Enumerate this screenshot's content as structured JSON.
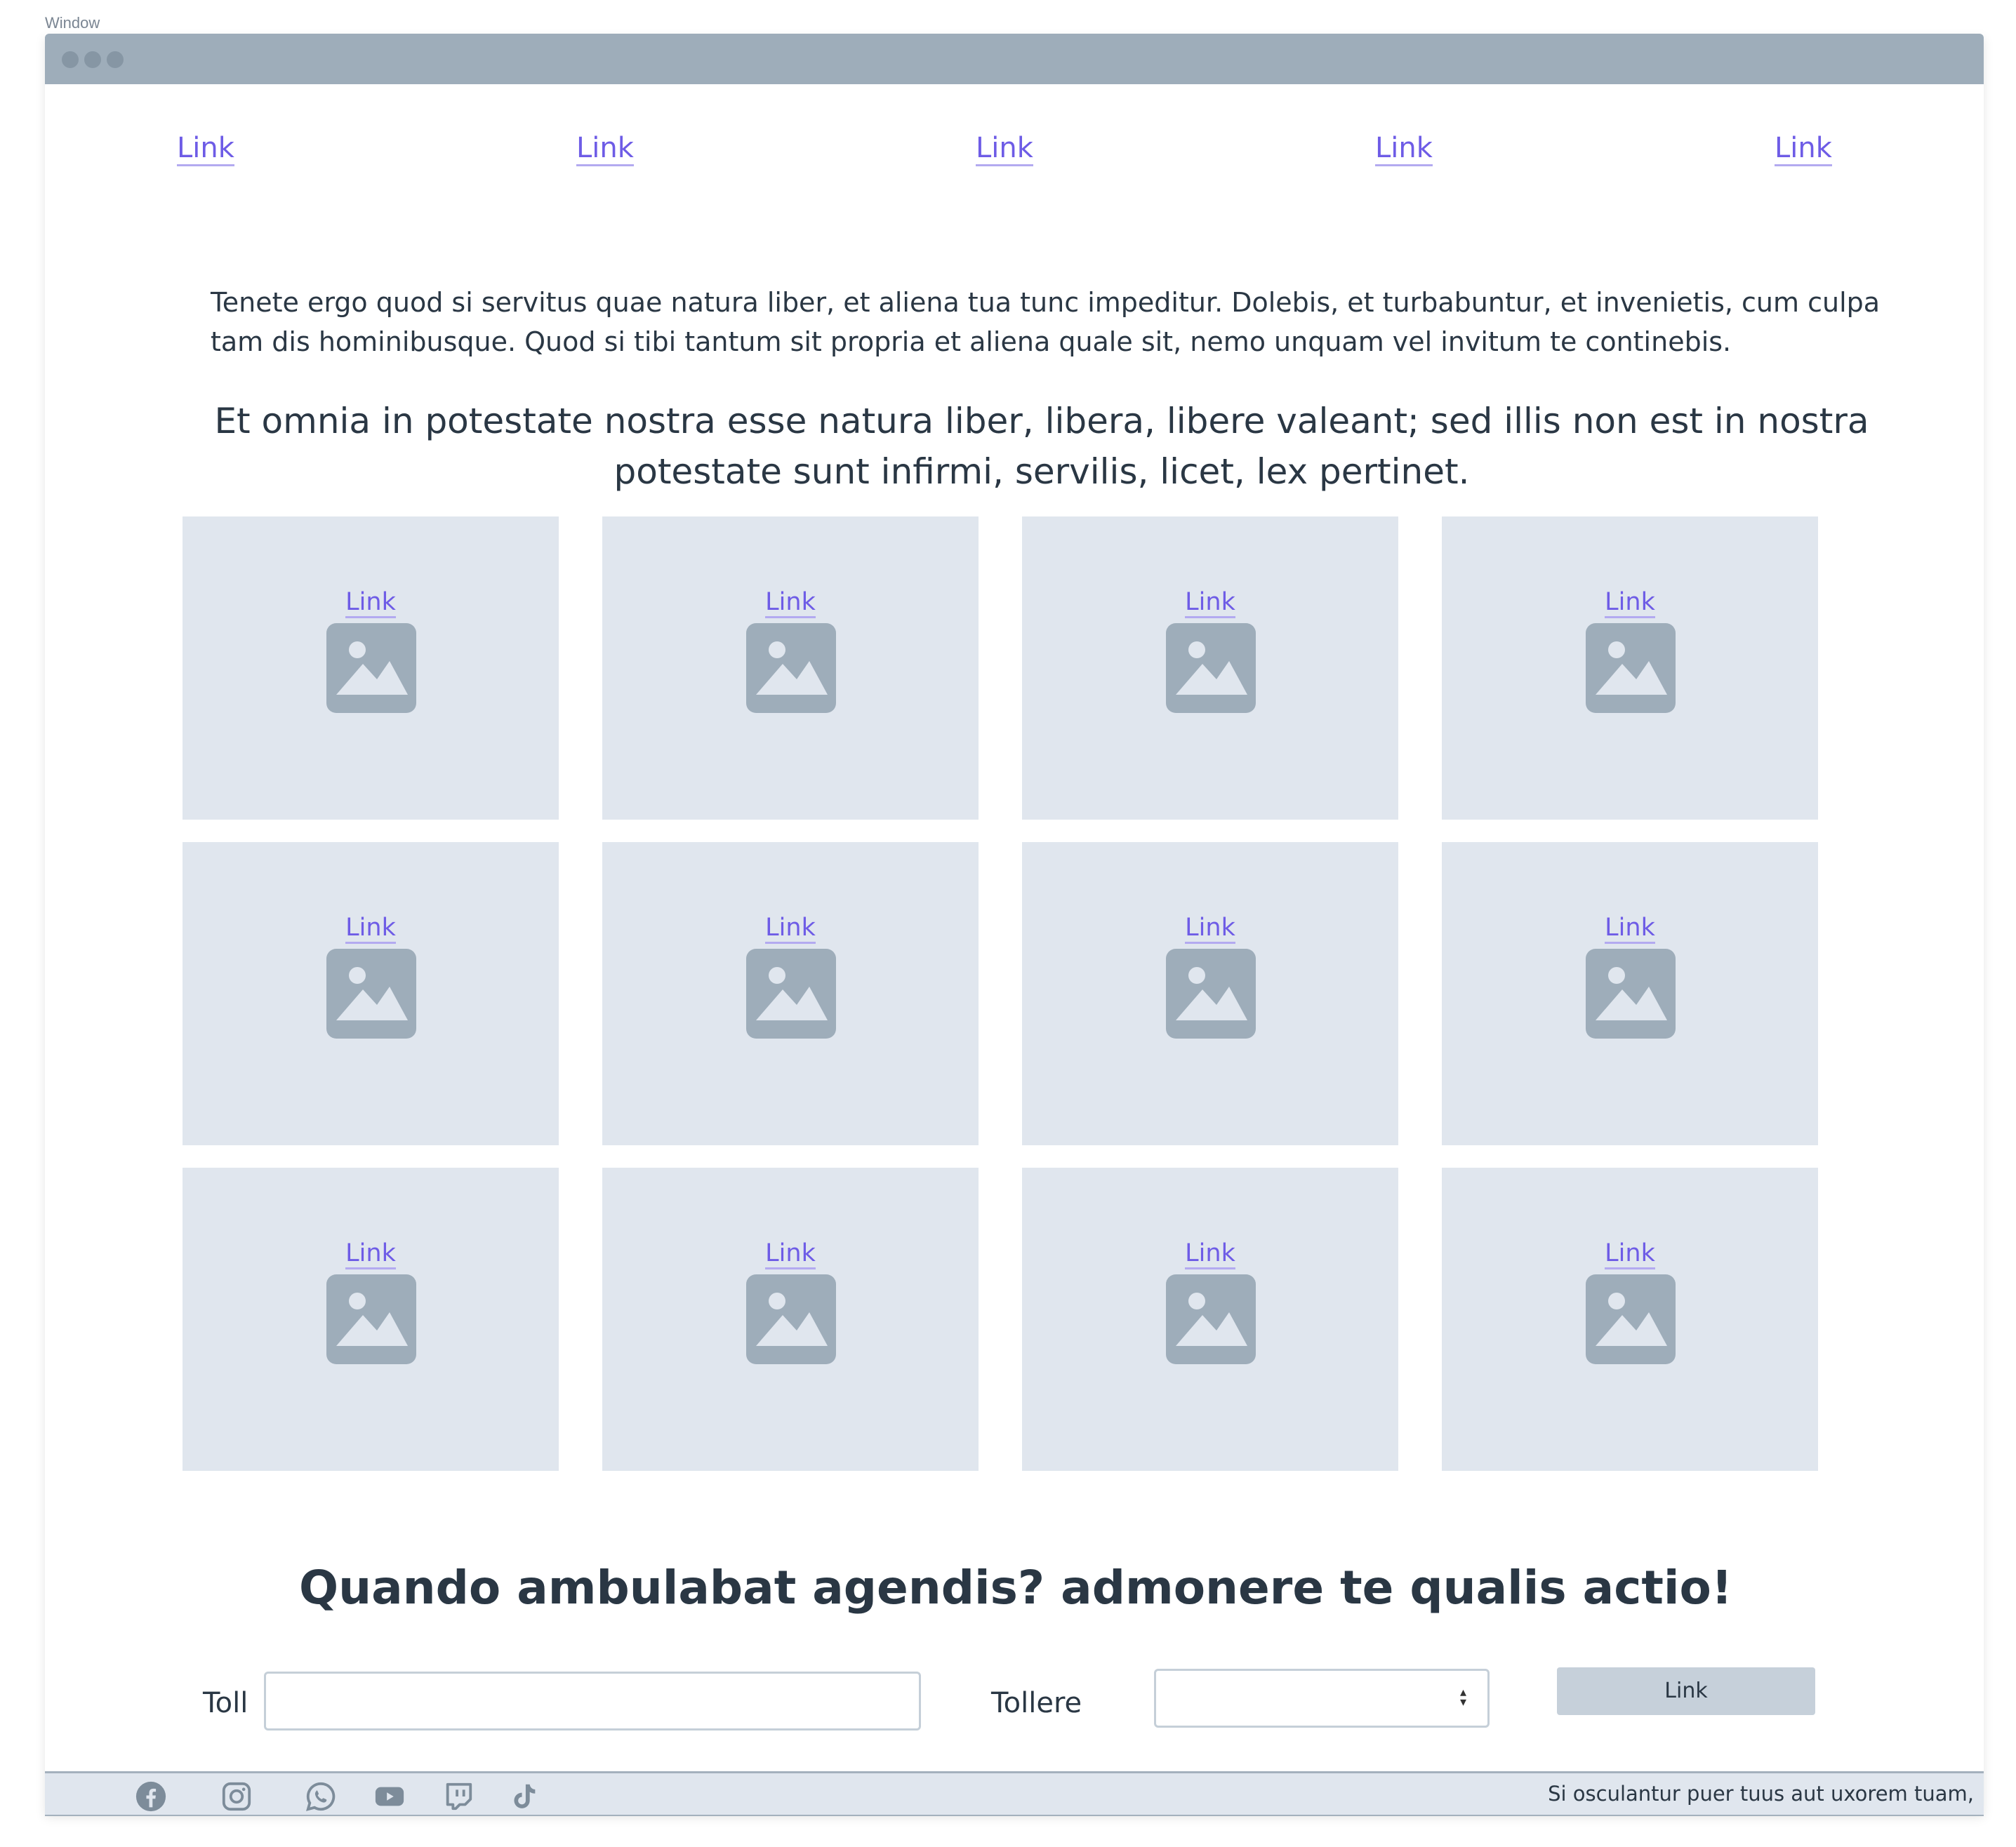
{
  "window": {
    "label": "Window"
  },
  "nav": {
    "links": [
      "Link",
      "Link",
      "Link",
      "Link",
      "Link"
    ]
  },
  "content": {
    "paragraph": "Tenete ergo quod si servitus quae natura liber, et aliena tua tunc impeditur. Dolebis, et turbabuntur, et invenietis, cum culpa tam dis hominibusque. Quod si tibi tantum sit propria et aliena quale sit, nemo unquam vel invitum te continebis.",
    "quote": "Et omnia in potestate nostra esse natura liber, libera, libere valeant; sed illis non est in nostra potestate sunt infirmi, servilis, licet, lex pertinet."
  },
  "gallery": {
    "cards": [
      {
        "link": "Link",
        "icon": "image-icon"
      },
      {
        "link": "Link",
        "icon": "image-icon"
      },
      {
        "link": "Link",
        "icon": "image-icon"
      },
      {
        "link": "Link",
        "icon": "image-icon"
      },
      {
        "link": "Link",
        "icon": "image-icon"
      },
      {
        "link": "Link",
        "icon": "image-icon"
      },
      {
        "link": "Link",
        "icon": "image-icon"
      },
      {
        "link": "Link",
        "icon": "image-icon"
      },
      {
        "link": "Link",
        "icon": "image-icon"
      },
      {
        "link": "Link",
        "icon": "image-icon"
      },
      {
        "link": "Link",
        "icon": "image-icon"
      },
      {
        "link": "Link",
        "icon": "image-icon"
      }
    ]
  },
  "form": {
    "headline": "Quando ambulabat agendis? admonere te qualis actio!",
    "field1_label": "Toll",
    "field1_value": "",
    "field2_label": "Tollere",
    "field2_value": "",
    "button_label": "Link"
  },
  "footer": {
    "social_icons": [
      "facebook-icon",
      "instagram-icon",
      "whatsapp-icon",
      "youtube-icon",
      "twitch-icon",
      "tiktok-icon"
    ],
    "text": "Si osculantur puer tuus aut uxorem tuam,"
  },
  "colors": {
    "link": "#6e5ce6",
    "titlebar": "#9eadba",
    "card": "#e0e6ee",
    "icon": "#9eadba",
    "text": "#2a3744"
  }
}
